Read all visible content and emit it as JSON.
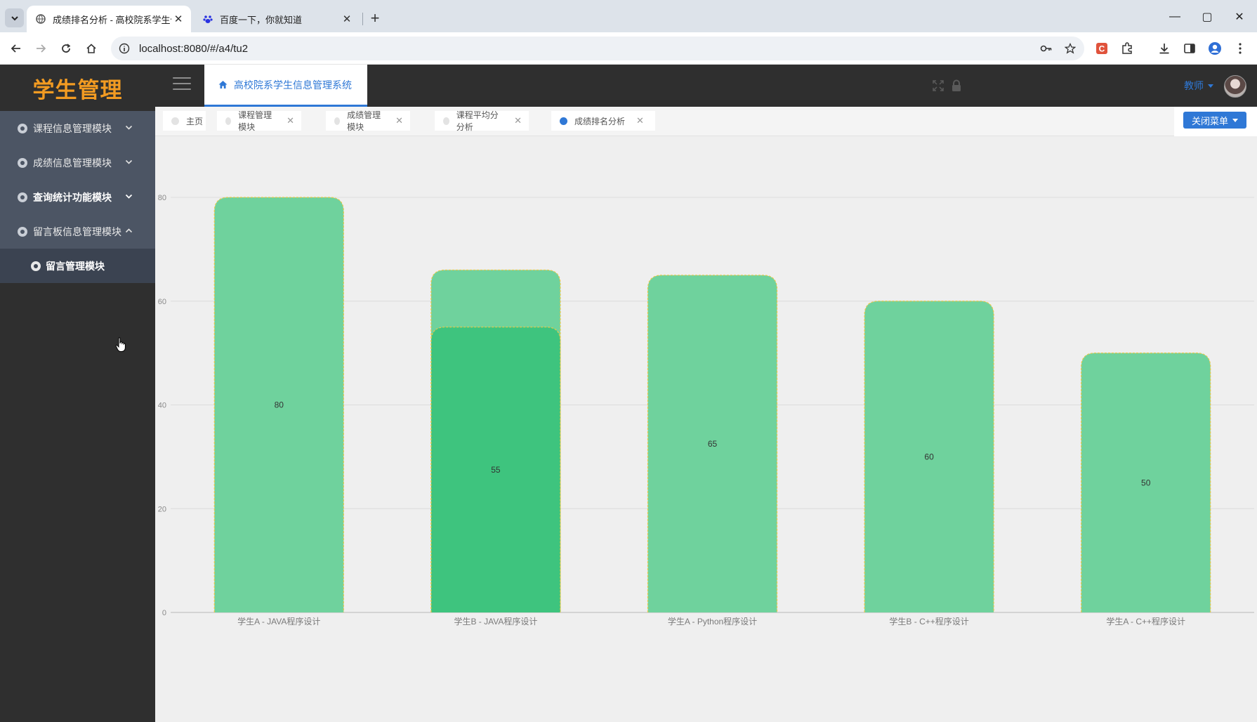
{
  "browser": {
    "tabs": [
      {
        "title": "成绩排名分析 - 高校院系学生信",
        "active": true
      },
      {
        "title": "百度一下，你就知道",
        "active": false
      }
    ],
    "url": "localhost:8080/#/a4/tu2"
  },
  "app": {
    "brand": "学生管理",
    "header_tab": "高校院系学生信息管理系统",
    "role": "教师",
    "close_menu_label": "关闭菜单",
    "menu": [
      {
        "label": "课程信息管理模块",
        "expanded": false
      },
      {
        "label": "成绩信息管理模块",
        "expanded": false
      },
      {
        "label": "查询统计功能模块",
        "expanded": false
      },
      {
        "label": "留言板信息管理模块",
        "expanded": true
      }
    ],
    "submenu": [
      {
        "label": "留言管理模块"
      }
    ],
    "tags": [
      {
        "label": "主页",
        "closable": false,
        "active": false
      },
      {
        "label": "课程管理模块",
        "closable": true,
        "active": false
      },
      {
        "label": "成绩管理模块",
        "closable": true,
        "active": false
      },
      {
        "label": "课程平均分分析",
        "closable": true,
        "active": false
      },
      {
        "label": "成绩排名分析",
        "closable": true,
        "active": true
      }
    ],
    "colors": {
      "accent": "#2f78d6",
      "brand": "#f29b22",
      "bar": "#6fd29d",
      "bar_highlight": "#3ec47e",
      "bar_border": "#e6c84a"
    }
  },
  "chart_data": {
    "type": "bar",
    "categories": [
      "学生A - JAVA程序设计",
      "学生B - JAVA程序设计",
      "学生A - Python程序设计",
      "学生B - C++程序设计",
      "学生A - C++程序设计"
    ],
    "values": [
      80,
      55,
      65,
      60,
      50
    ],
    "ylim": [
      0,
      80
    ],
    "yticks": [
      0,
      20,
      40,
      60,
      80
    ],
    "grid": true,
    "highlighted_index": 1,
    "highlight_backdrop_value": 66
  }
}
